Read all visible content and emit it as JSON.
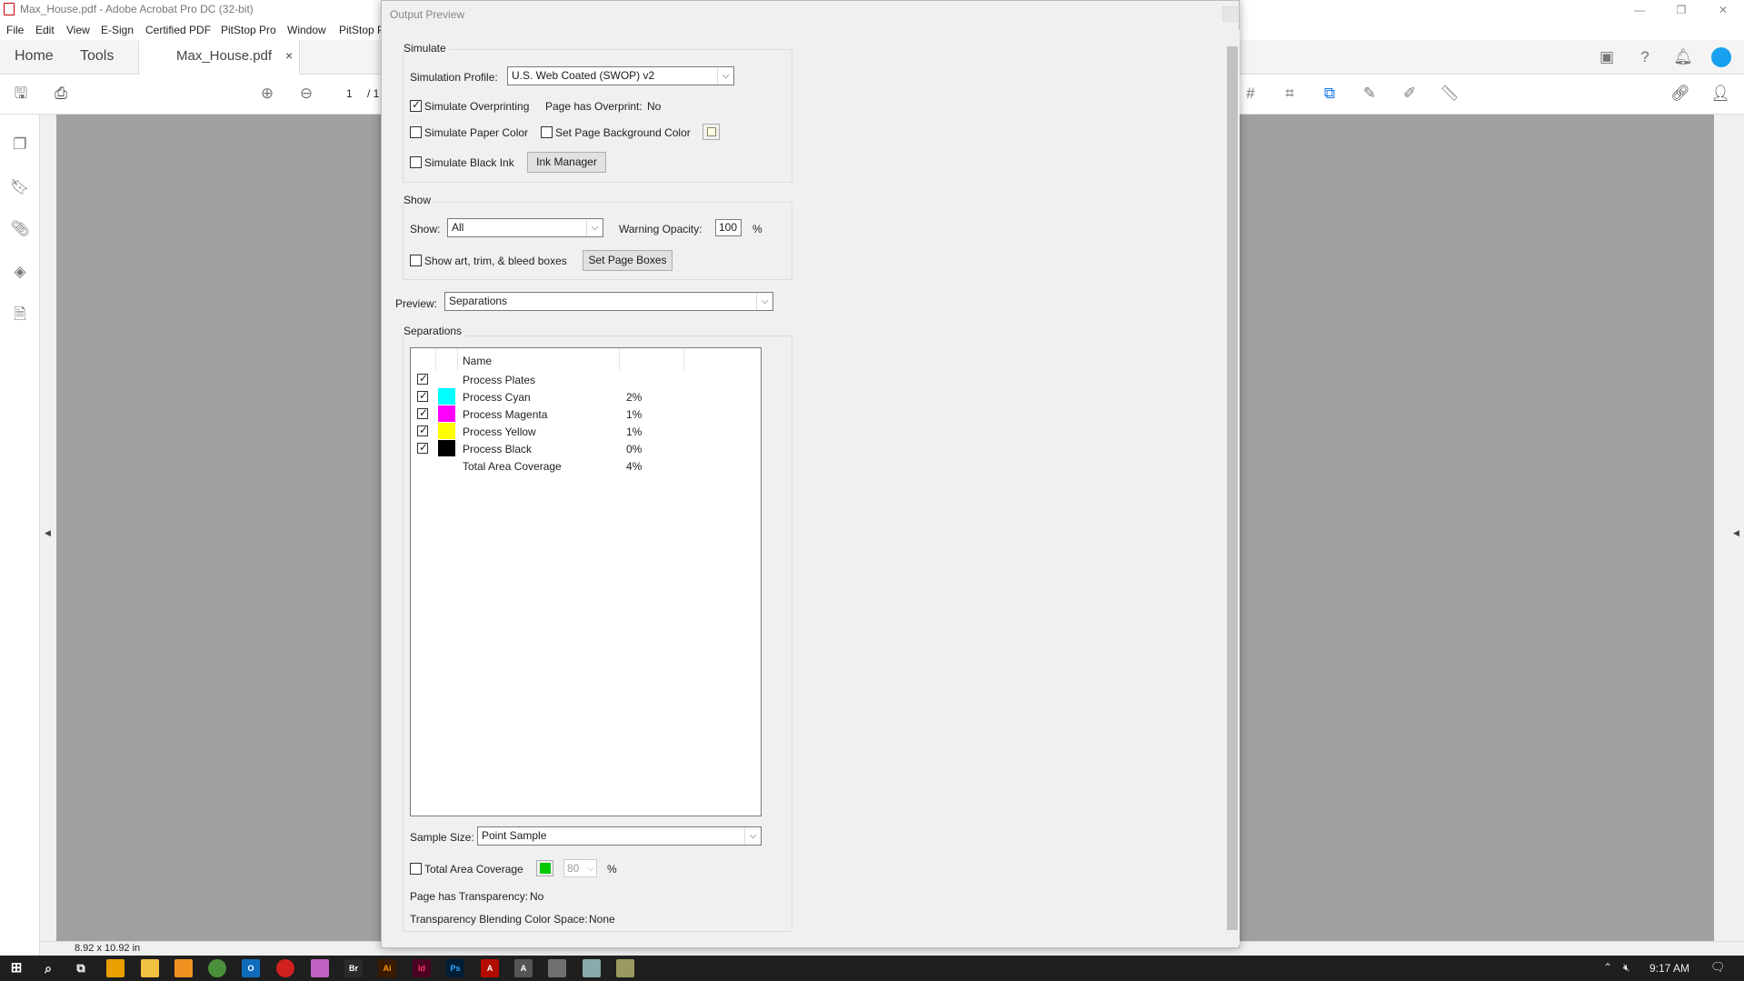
{
  "app": {
    "window_title": "Max_House.pdf - Adobe Acrobat Pro DC (32-bit)",
    "menu": [
      "File",
      "Edit",
      "View",
      "E-Sign",
      "Certified PDF",
      "PitStop Pro",
      "Window",
      "PitStop P"
    ],
    "tabs": {
      "home": "Home",
      "tools": "Tools",
      "document": "Max_House.pdf",
      "close": "×"
    },
    "page_nav": {
      "current": "1",
      "total": "/ 1"
    },
    "status_size": "8.92 x 10.92 in"
  },
  "dialog": {
    "title": "Output Preview",
    "simulate": {
      "label": "Simulate",
      "profile_label": "Simulation Profile:",
      "profile_value": "U.S. Web Coated (SWOP) v2",
      "overprint_label": "Simulate Overprinting",
      "overprint_checked": true,
      "page_overprint_label": "Page has Overprint:",
      "page_overprint_value": "No",
      "paper_color_label": "Simulate Paper Color",
      "bg_color_label": "Set Page Background Color",
      "black_ink_label": "Simulate Black Ink",
      "ink_manager": "Ink Manager"
    },
    "show": {
      "label": "Show",
      "show_label": "Show:",
      "show_value": "All",
      "opacity_label": "Warning Opacity:",
      "opacity_value": "100",
      "percent": "%",
      "boxes_label": "Show art, trim, & bleed boxes",
      "page_boxes_button": "Set Page Boxes"
    },
    "preview": {
      "label": "Preview:",
      "value": "Separations"
    },
    "separations": {
      "label": "Separations",
      "name_header": "Name",
      "rows": [
        {
          "name": "Process Plates",
          "value": "",
          "color": "",
          "checked": true
        },
        {
          "name": "Process Cyan",
          "value": "2%",
          "color": "#00ffff",
          "checked": true
        },
        {
          "name": "Process Magenta",
          "value": "1%",
          "color": "#ff00ff",
          "checked": true
        },
        {
          "name": "Process Yellow",
          "value": "1%",
          "color": "#ffff00",
          "checked": true
        },
        {
          "name": "Process Black",
          "value": "0%",
          "color": "#000000",
          "checked": true
        },
        {
          "name": "Total Area Coverage",
          "value": "4%",
          "color": "",
          "checked": null
        }
      ]
    },
    "sample": {
      "label": "Sample Size:",
      "value": "Point Sample"
    },
    "tac": {
      "label": "Total Area Coverage",
      "value": "80",
      "percent": "%",
      "swatch_color": "#00c800"
    },
    "transparency": {
      "label": "Page has Transparency:",
      "value": "No"
    },
    "blending": {
      "label": "Transparency Blending Color Space:",
      "value": "None"
    }
  },
  "taskbar": {
    "time": "9:17 AM"
  }
}
